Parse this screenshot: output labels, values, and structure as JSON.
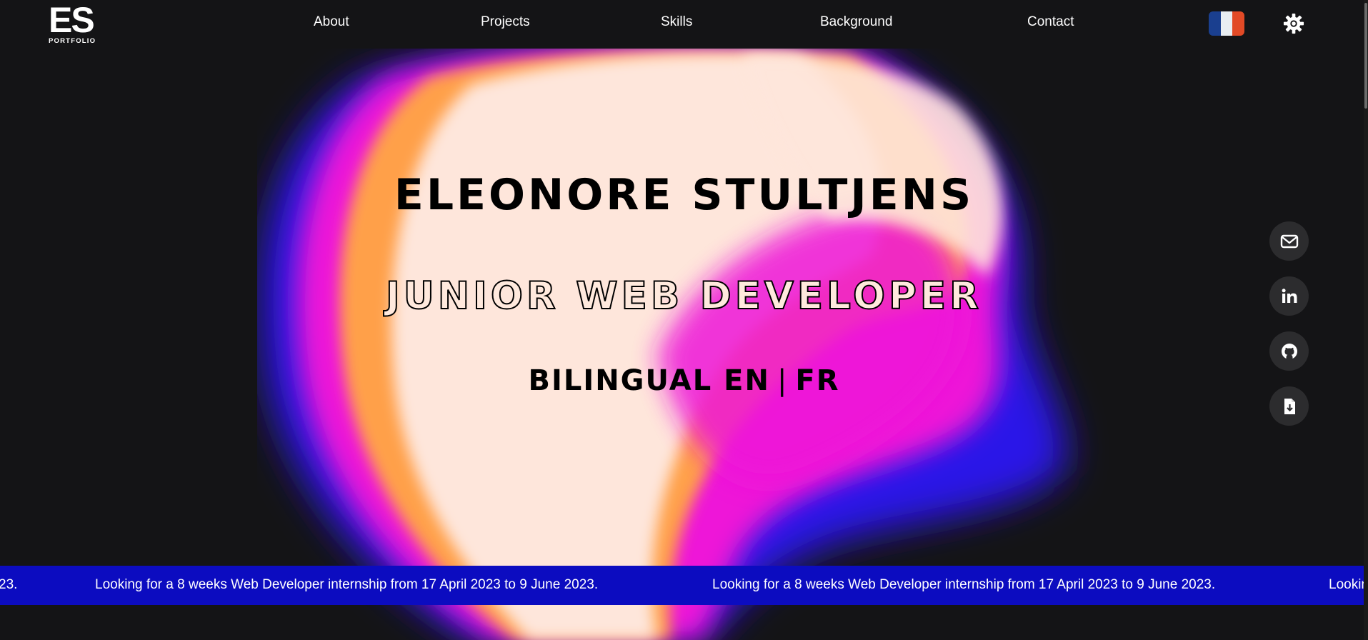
{
  "logo": {
    "mark": "ES",
    "subtitle": "PORTFOLIO"
  },
  "nav": {
    "links": [
      "About",
      "Projects",
      "Skills",
      "Background",
      "Contact"
    ]
  },
  "flag": {
    "colors": [
      "#1a3f8f",
      "#e9eef2",
      "#e24a26"
    ]
  },
  "hero": {
    "name": "ELEONORE STULTJENS",
    "role": "JUNIOR WEB DEVELOPER",
    "lang_main": "BILINGUAL EN",
    "lang_sep": "|",
    "lang_alt": "FR"
  },
  "social": [
    "mail-icon",
    "linkedin-icon",
    "github-icon",
    "download-cv-icon"
  ],
  "banner": {
    "text": "Looking for a 8 weeks Web Developer internship from 17 April 2023 to 9 June 2023.",
    "left_fragment": "23.",
    "right_fragment": "Looking"
  },
  "colors": {
    "background": "#141416",
    "banner": "#0c0cc0",
    "blob_cream": "#fee6db",
    "blob_magenta": "#ee18d8",
    "blob_orange": "#ffa04a",
    "blob_blue": "#2a12e8"
  }
}
